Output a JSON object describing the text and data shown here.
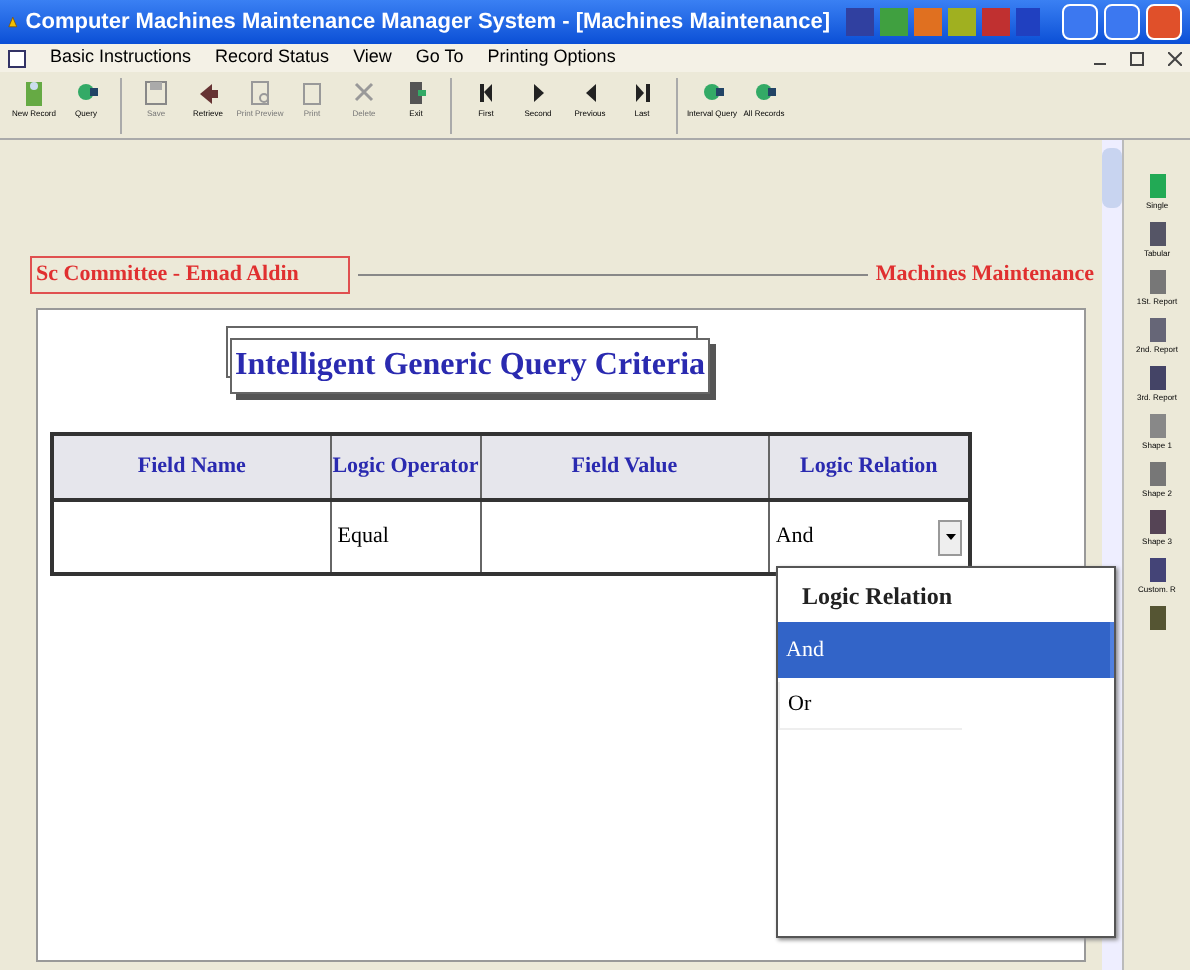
{
  "window": {
    "title": "Computer Machines Maintenance Manager System - [Machines Maintenance]"
  },
  "menu": [
    "Basic Instructions",
    "Record Status",
    "View",
    "Go To",
    "Printing Options"
  ],
  "toolbar": [
    {
      "label": "New Record",
      "disabled": false
    },
    {
      "label": "Query",
      "disabled": false
    },
    {
      "label": "Save",
      "disabled": true
    },
    {
      "label": "Retrieve",
      "disabled": false
    },
    {
      "label": "Print Preview",
      "disabled": true
    },
    {
      "label": "Print",
      "disabled": true
    },
    {
      "label": "Delete",
      "disabled": true
    },
    {
      "label": "Exit",
      "disabled": false
    },
    {
      "label": "First",
      "disabled": false
    },
    {
      "label": "Second",
      "disabled": false
    },
    {
      "label": "Previous",
      "disabled": false
    },
    {
      "label": "Last",
      "disabled": false
    },
    {
      "label": "Interval Query",
      "disabled": false
    },
    {
      "label": "All Records",
      "disabled": false
    }
  ],
  "header_left": "Sc Committee - Emad Aldin",
  "header_right": "Machines Maintenance",
  "form_title": "Intelligent Generic Query Criteria",
  "table": {
    "columns": [
      "Field Name",
      "Logic Operator",
      "Field Value",
      "Logic Relation"
    ],
    "rows": [
      {
        "field_name": "",
        "logic_operator": "Equal",
        "field_value": "",
        "logic_relation": "And"
      }
    ]
  },
  "dropdown": {
    "header": "Logic Relation",
    "options": [
      {
        "label": "And",
        "selected": true
      },
      {
        "label": "Or",
        "selected": false
      }
    ]
  },
  "side_panel": [
    "Single",
    "Tabular",
    "1St. Report",
    "2nd. Report",
    "3rd. Report",
    "Shape 1",
    "Shape 2",
    "Shape 3",
    "Custom. R"
  ]
}
